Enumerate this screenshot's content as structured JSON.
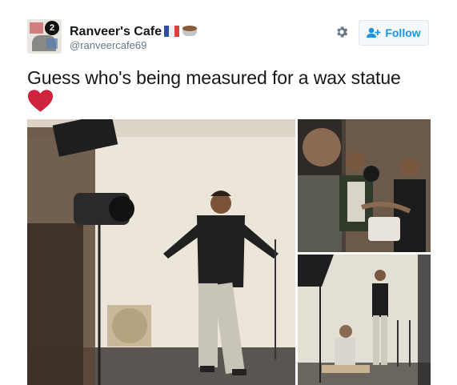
{
  "user": {
    "display_name": "Ranveer's Cafe",
    "handle": "@ranveercafe69",
    "avatar_badge": "2"
  },
  "actions": {
    "follow_label": "Follow",
    "settings_icon": "gear-icon",
    "follow_icon": "add-user-icon"
  },
  "tweet": {
    "text": "Guess who's being measured for a wax statue",
    "emoji": "red-heart"
  },
  "colors": {
    "accent": "#1b95e0",
    "text": "#14171a",
    "secondary": "#657786",
    "heart": "#d0233d",
    "flag_blue": "#2a4fa3",
    "flag_white": "#ffffff",
    "flag_red": "#e53b3b"
  },
  "media": [
    {
      "id": "photo-main"
    },
    {
      "id": "photo-top-right"
    },
    {
      "id": "photo-bottom-right"
    }
  ]
}
